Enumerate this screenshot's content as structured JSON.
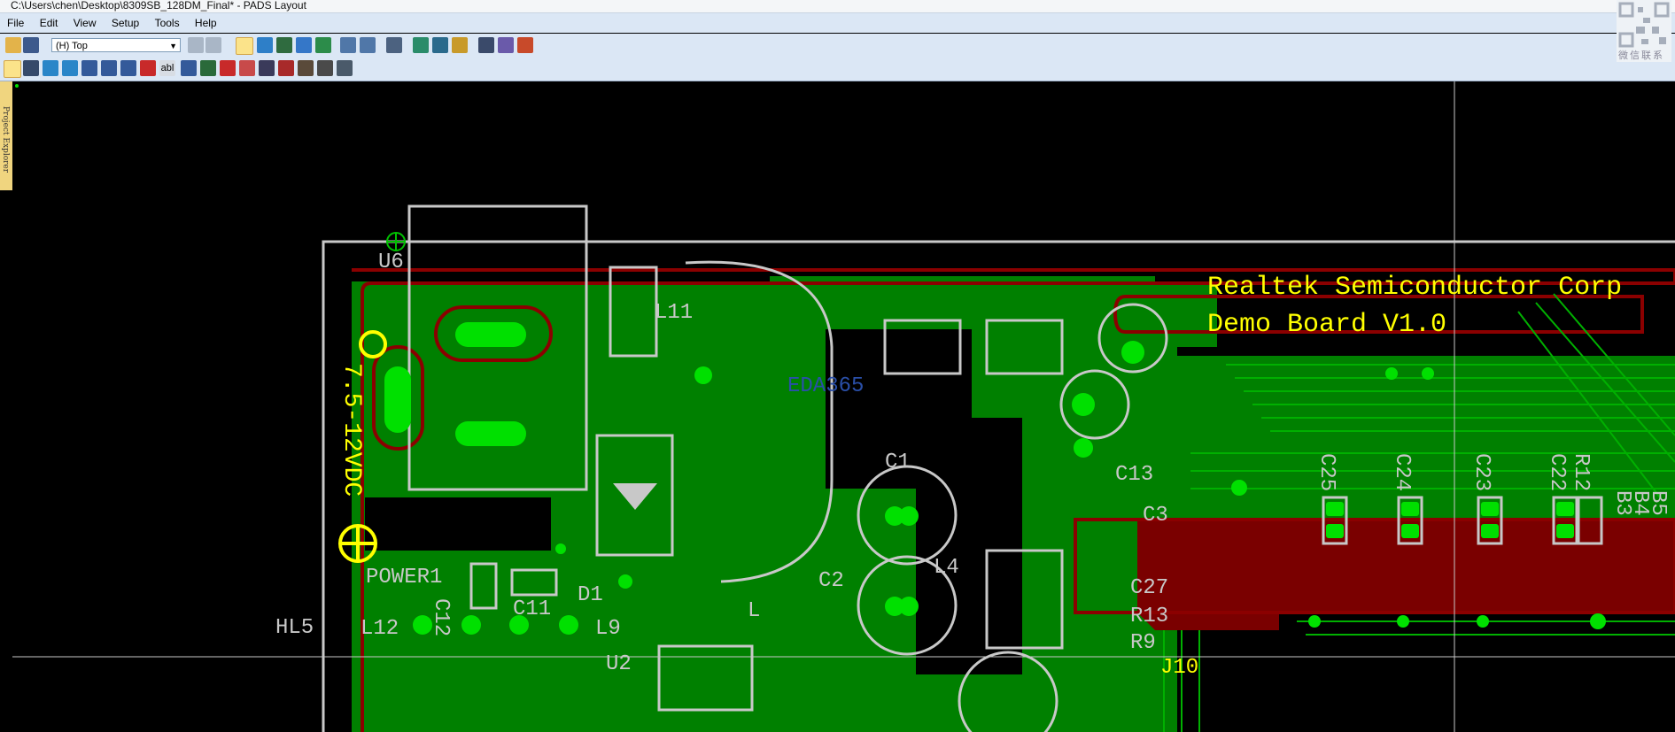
{
  "window": {
    "title": "C:\\Users\\chen\\Desktop\\8309SB_128DM_Final* - PADS Layout"
  },
  "menu": {
    "items": [
      "File",
      "Edit",
      "View",
      "Setup",
      "Tools",
      "Help"
    ]
  },
  "layer_select": {
    "value": "(H) Top"
  },
  "side_panel": {
    "label": "Project Explorer"
  },
  "watermark": {
    "caption": "微信联系",
    "brand": "EDA365"
  },
  "pcb": {
    "silk_title": "Realtek Semiconductor Corp",
    "silk_subtitle": "Demo Board V1.0",
    "refdes": [
      "U6",
      "L11",
      "C1",
      "C13",
      "C25",
      "C24",
      "C23",
      "C22",
      "R12",
      "B5",
      "B4",
      "B3",
      "C3",
      "C27",
      "R13",
      "R9",
      "C2",
      "L4",
      "POWER1",
      "C12",
      "C11",
      "D1",
      "L12",
      "L9",
      "U2",
      "HL5",
      "J10",
      "L"
    ],
    "yellow_label": "7.5-12VDC"
  },
  "colors": {
    "copper": "#008000",
    "keepout": "#8b0000",
    "silk": "#c8c8c8",
    "pad": "#00e000",
    "label": "#ffff00"
  }
}
